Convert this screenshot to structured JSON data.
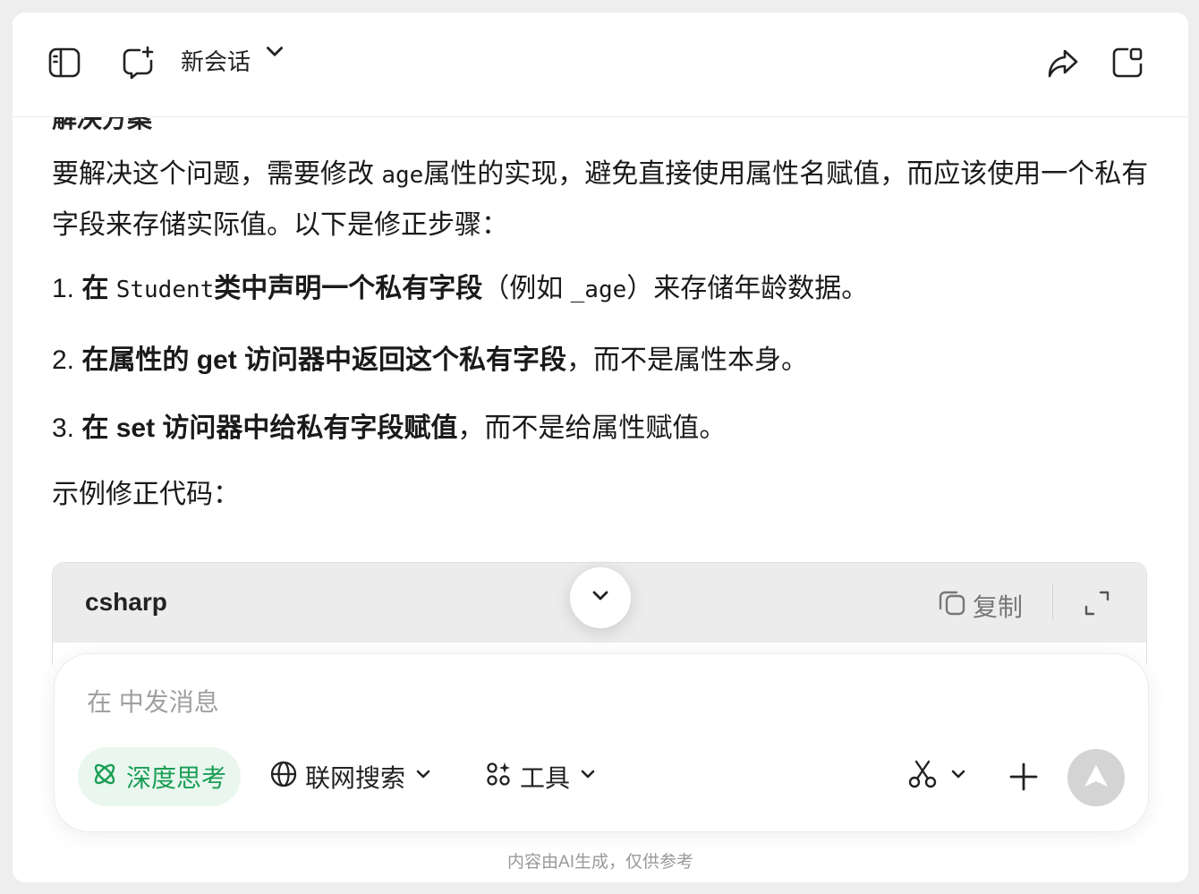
{
  "header": {
    "title": "新会话",
    "icons": [
      "sidebar-toggle-icon",
      "new-chat-icon",
      "chevron-down-icon",
      "share-icon",
      "window-icon"
    ]
  },
  "message": {
    "clipped_heading": "解决方案",
    "intro_before": "要解决这个问题，需要修改 ",
    "intro_code": "age",
    "intro_after": "属性的实现，避免直接使用属性名赋值，而应该使用一个私有字段来存储实际值。以下是修正步骤：",
    "steps": [
      {
        "num": "1.",
        "bold_a": "在 ",
        "code": "Student",
        "bold_b": "类中声明一个私有字段",
        "rest_a": "（例如 ",
        "code2": "_age",
        "rest_b": "）来存储年龄数据。"
      },
      {
        "num": "2.",
        "bold": "在属性的 get 访问器中返回这个私有字段",
        "rest": "，而不是属性本身。"
      },
      {
        "num": "3.",
        "bold": "在 set 访问器中给私有字段赋值",
        "rest": "，而不是给属性赋值。"
      }
    ],
    "example_label": "示例修正代码："
  },
  "code_block": {
    "language": "csharp",
    "copy_label": "复制"
  },
  "composer": {
    "placeholder": "在 中发消息",
    "deep_think_label": "深度思考",
    "web_search_label": "联网搜索",
    "tools_label": "工具"
  },
  "footer": {
    "disclaimer": "内容由AI生成，仅供参考"
  },
  "colors": {
    "accent_green": "#1a9e55",
    "accent_green_bg": "#e9f7ef",
    "send_disabled": "#d4d4d4"
  }
}
